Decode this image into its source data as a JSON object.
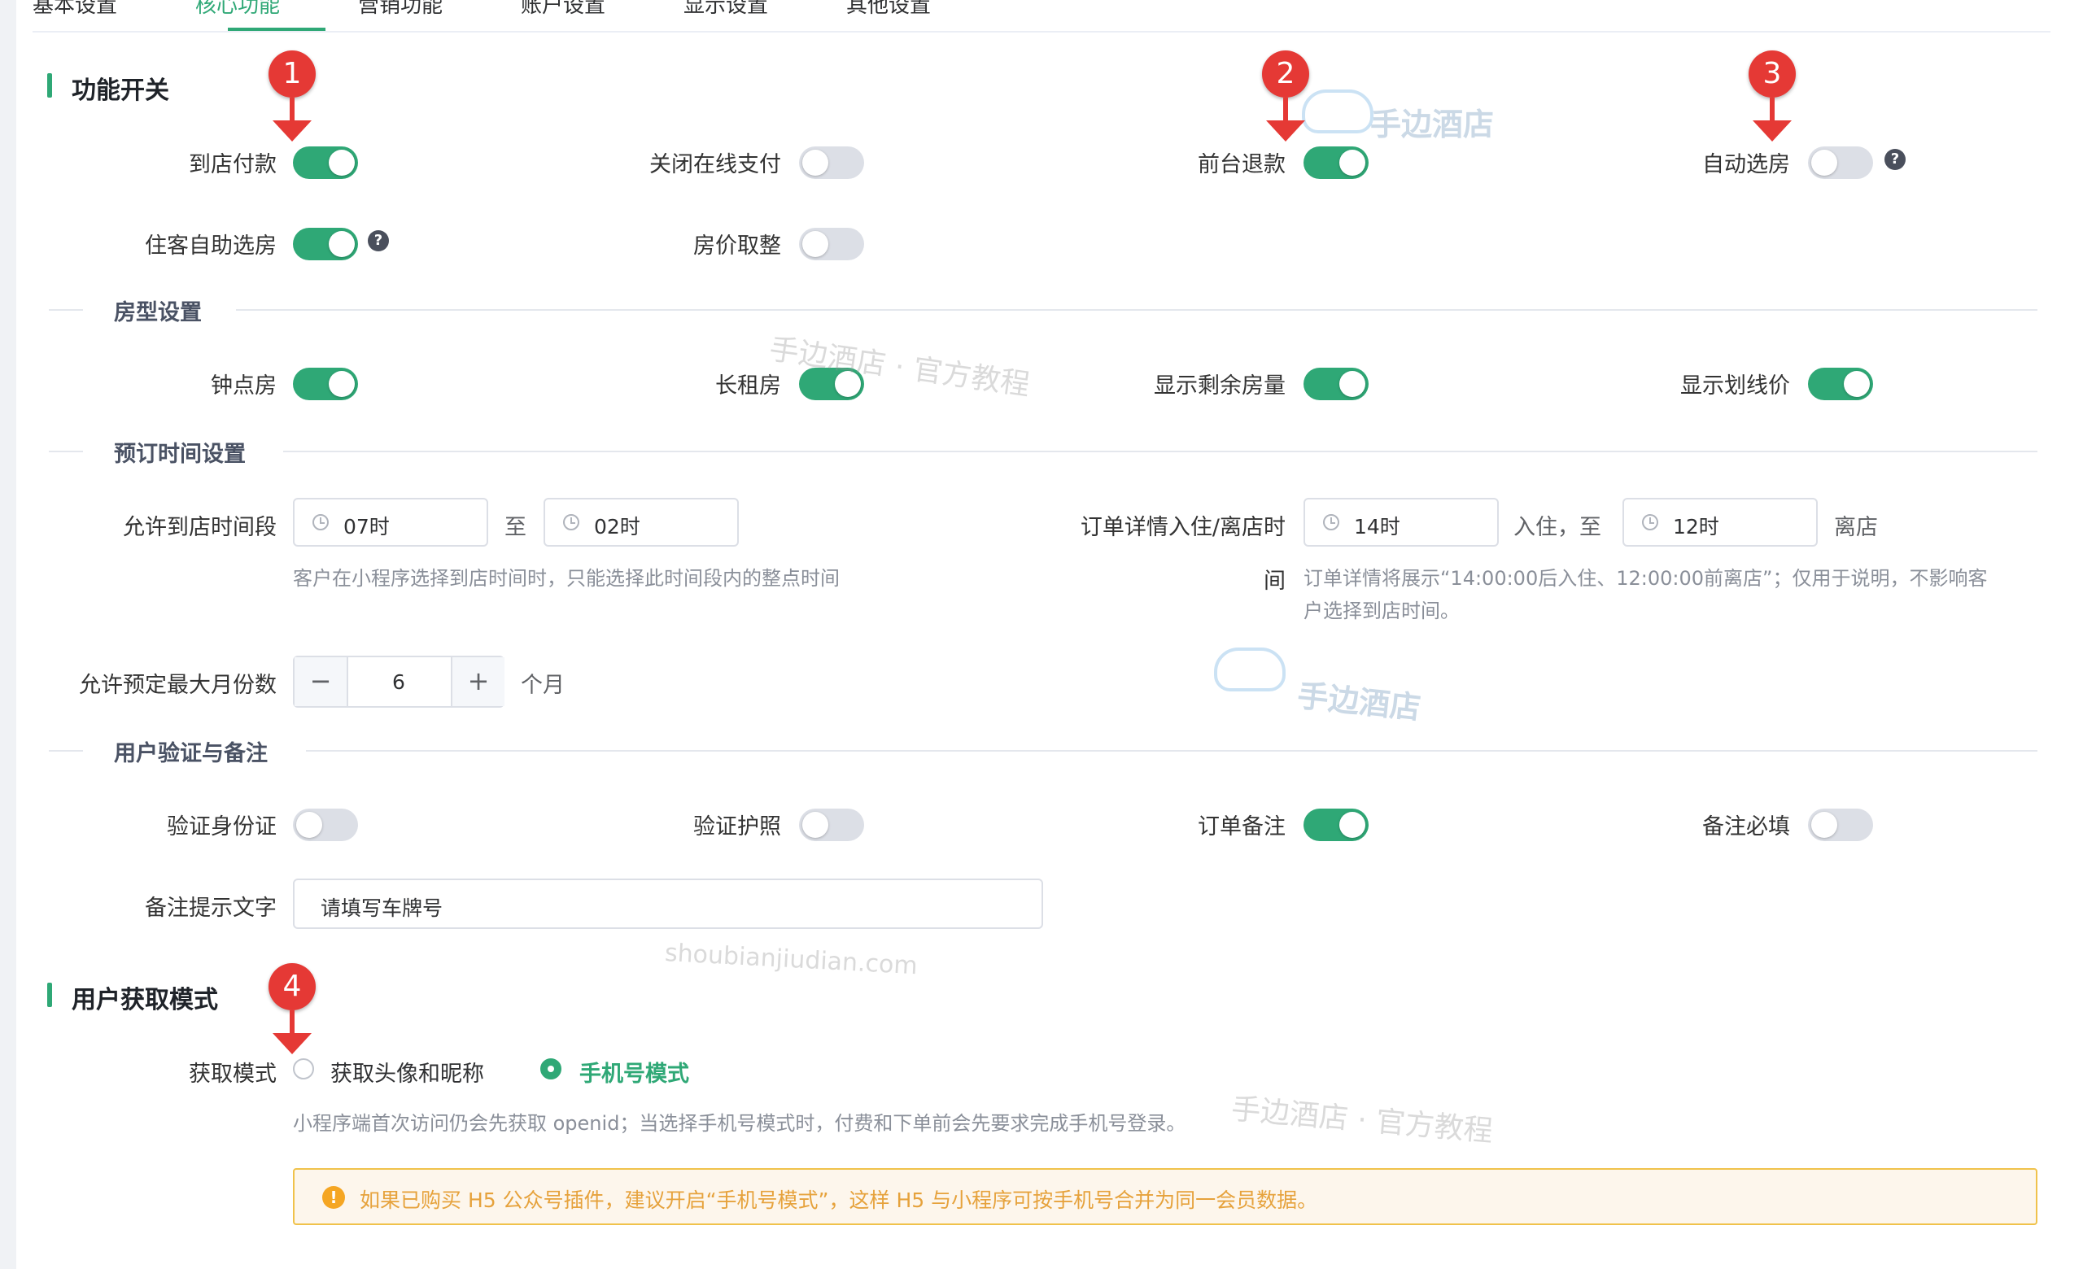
{
  "tabs": [
    "基本设置",
    "核心功能",
    "营销功能",
    "账户设置",
    "显示设置",
    "其他设置"
  ],
  "active_tab": 1,
  "section_function": {
    "title": "功能开关",
    "switches": [
      {
        "label": "到店付款",
        "on": true,
        "help": false
      },
      {
        "label": "关闭在线支付",
        "on": false,
        "help": false
      },
      {
        "label": "前台退款",
        "on": true,
        "help": false
      },
      {
        "label": "自动选房",
        "on": false,
        "help": true
      },
      {
        "label": "住客自助选房",
        "on": true,
        "help": true
      },
      {
        "label": "房价取整",
        "on": false,
        "help": false
      }
    ]
  },
  "room_type": {
    "title": "房型设置",
    "switches": [
      {
        "label": "钟点房",
        "on": true
      },
      {
        "label": "长租房",
        "on": true
      },
      {
        "label": "显示剩余房量",
        "on": true
      },
      {
        "label": "显示划线价",
        "on": true
      }
    ]
  },
  "booking_time": {
    "title": "预订时间设置",
    "arrival_label": "允许到店时间段",
    "arrival_start": "07时",
    "arrival_sep": "至",
    "arrival_end": "02时",
    "arrival_hint": "客户在小程序选择到店时间时，只能选择此时间段内的整点时间",
    "detail_label": "订单详情入住/离店时",
    "detail_label_cont": "间",
    "checkin": "14时",
    "checkin_suffix": "入住，至",
    "checkout": "12时",
    "checkout_suffix": "离店",
    "detail_hint_1": "订单详情将展示“14:00:00后入住、12:00:00前离店”；仅用于说明，不影响客",
    "detail_hint_2": "户选择到店时间。",
    "max_month_label": "允许预定最大月份数",
    "max_month_value": "6",
    "max_month_unit": "个月",
    "minus": "−",
    "plus": "+"
  },
  "verification": {
    "title": "用户验证与备注",
    "switches": [
      {
        "label": "验证身份证",
        "on": false
      },
      {
        "label": "验证护照",
        "on": false
      },
      {
        "label": "订单备注",
        "on": true
      },
      {
        "label": "备注必填",
        "on": false
      }
    ],
    "remark_label": "备注提示文字",
    "remark_value": "请填写车牌号"
  },
  "user_mode": {
    "title": "用户获取模式",
    "label": "获取模式",
    "options": [
      {
        "label": "获取头像和昵称",
        "checked": false
      },
      {
        "label": "手机号模式",
        "checked": true
      }
    ],
    "hint": "小程序端首次访问仍会先获取 openid；当选择手机号模式时，付费和下单前会先要求完成手机号登录。",
    "alert": "如果已购买 H5 公众号插件，建议开启“手机号模式”，这样 H5 与小程序可按手机号合并为同一会员数据。"
  },
  "markers": [
    "1",
    "2",
    "3",
    "4"
  ],
  "watermarks": {
    "logo_text": "手边酒店",
    "tutorial": "手边酒店 · 官方教程",
    "domain": "shoubianjiudian.com"
  },
  "colors": {
    "accent": "#2fa876",
    "marker": "#e53935",
    "warning": "#e6a23c"
  }
}
